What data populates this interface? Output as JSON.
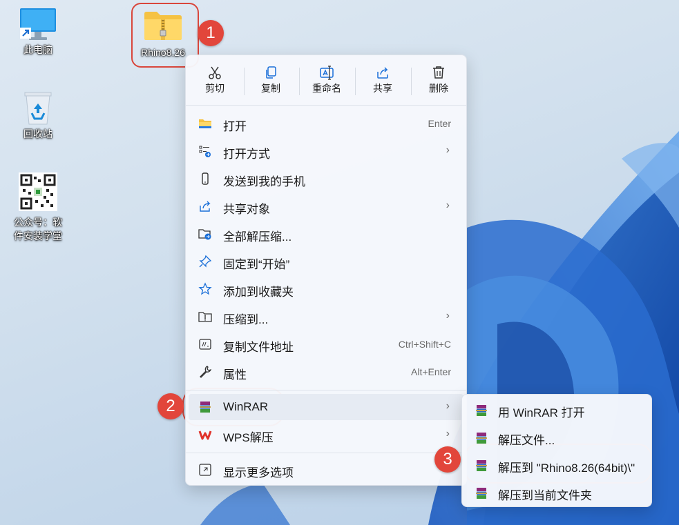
{
  "desktop": {
    "icons": [
      {
        "label": "此电脑"
      },
      {
        "label": "回收站"
      },
      {
        "label_line1": "公众号：软",
        "label_line2": "件安装学堂"
      },
      {
        "label": "Rhino8.26"
      }
    ]
  },
  "badges": [
    "1",
    "2",
    "3"
  ],
  "context_menu": {
    "toolbar": [
      {
        "label": "剪切",
        "icon": "scissors-icon"
      },
      {
        "label": "复制",
        "icon": "copy-icon"
      },
      {
        "label": "重命名",
        "icon": "rename-icon"
      },
      {
        "label": "共享",
        "icon": "share-icon"
      },
      {
        "label": "删除",
        "icon": "trash-icon"
      }
    ],
    "items": [
      {
        "label": "打开",
        "shortcut": "Enter",
        "icon": "folder-icon"
      },
      {
        "label": "打开方式",
        "arrow": "›",
        "icon": "open-with-icon"
      },
      {
        "label": "发送到我的手机",
        "icon": "phone-icon"
      },
      {
        "label": "共享对象",
        "arrow": "›",
        "icon": "share-icon"
      },
      {
        "label": "全部解压缩...",
        "icon": "extract-folder-icon"
      },
      {
        "label": "固定到“开始”",
        "icon": "pin-icon"
      },
      {
        "label": "添加到收藏夹",
        "icon": "star-icon"
      },
      {
        "label": "压缩到...",
        "arrow": "›",
        "icon": "compress-icon"
      },
      {
        "label": "复制文件地址",
        "shortcut": "Ctrl+Shift+C",
        "icon": "copy-path-icon"
      },
      {
        "label": "属性",
        "shortcut": "Alt+Enter",
        "icon": "wrench-icon"
      },
      {
        "label": "WinRAR",
        "arrow": "›",
        "icon": "winrar-icon"
      },
      {
        "label": "WPS解压",
        "arrow": "›",
        "icon": "wps-icon"
      },
      {
        "label": "显示更多选项",
        "icon": "more-options-icon"
      }
    ]
  },
  "submenu": {
    "items": [
      {
        "label": "用 WinRAR 打开"
      },
      {
        "label": "解压文件..."
      },
      {
        "label": "解压到 \"Rhino8.26(64bit)\\\""
      },
      {
        "label": "解压到当前文件夹"
      }
    ]
  },
  "colors": {
    "accent_red": "#e2463b",
    "menu_bg": "#f6f8fc",
    "highlight": "#e6ebf3"
  }
}
